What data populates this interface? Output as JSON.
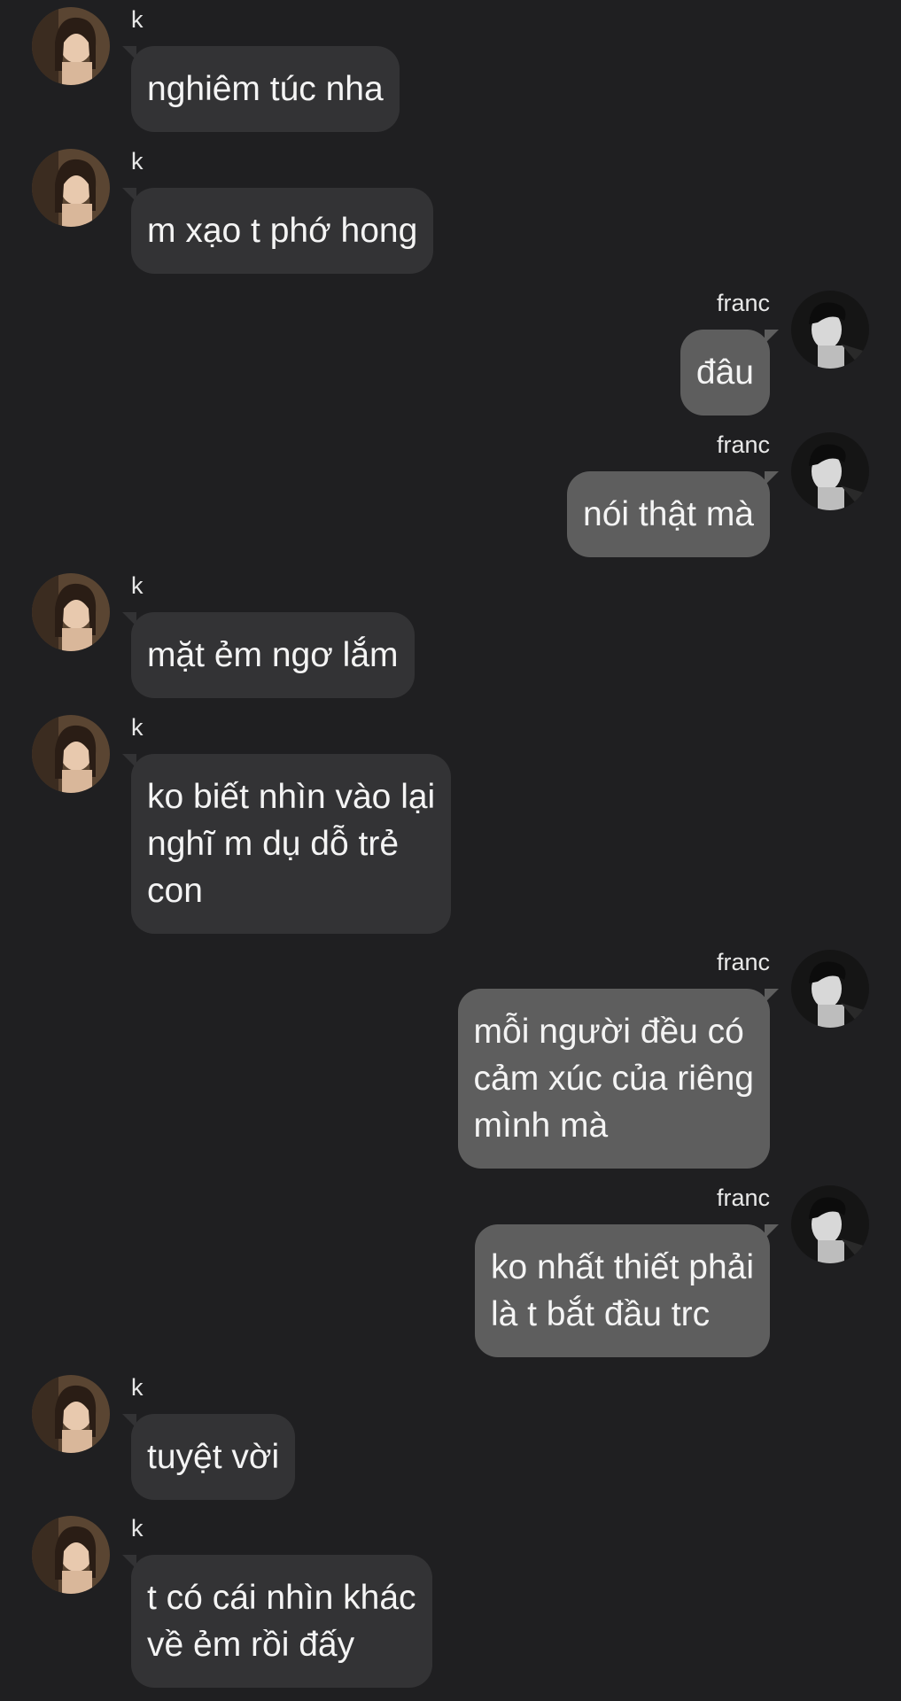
{
  "contacts": {
    "incoming_name": "k",
    "outgoing_name": "franc"
  },
  "messages": [
    {
      "sender": "k",
      "text": "nghiêm túc nha"
    },
    {
      "sender": "k",
      "text": "m xạo t phớ hong"
    },
    {
      "sender": "franc",
      "text": "đâu"
    },
    {
      "sender": "franc",
      "text": "nói thật mà"
    },
    {
      "sender": "k",
      "text": "mặt ẻm ngơ lắm"
    },
    {
      "sender": "k",
      "text": "ko biết nhìn vào lại\nnghĩ m dụ dỗ trẻ\ncon"
    },
    {
      "sender": "franc",
      "text": "mỗi người đều có\ncảm xúc của riêng\nmình mà"
    },
    {
      "sender": "franc",
      "text": "ko nhất thiết phải\nlà t bắt đầu trc"
    },
    {
      "sender": "k",
      "text": "tuyệt vời"
    },
    {
      "sender": "k",
      "text": "t có cái nhìn khác\nvề ẻm rồi đấy"
    }
  ],
  "colors": {
    "background": "#1f1f21",
    "incoming_bubble": "#333335",
    "outgoing_bubble": "#5e5e5e",
    "text": "#f4f4f4"
  },
  "icons": {
    "incoming_avatar": "avatar-k-icon",
    "outgoing_avatar": "avatar-franc-icon"
  }
}
